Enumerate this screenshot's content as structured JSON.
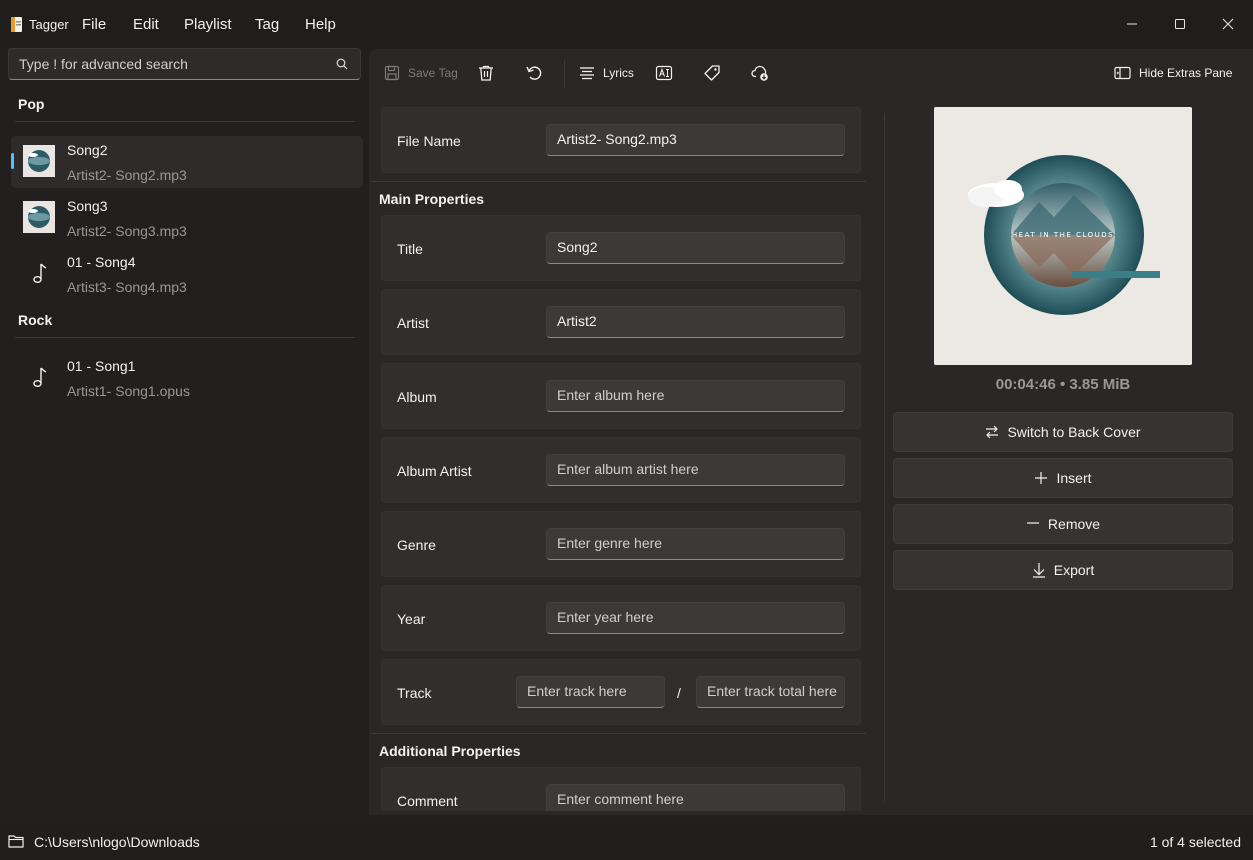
{
  "app": {
    "title": "Tagger"
  },
  "menu": {
    "file": "File",
    "edit": "Edit",
    "playlist": "Playlist",
    "tag": "Tag",
    "help": "Help"
  },
  "search": {
    "placeholder": "Type ! for advanced search"
  },
  "groups": [
    {
      "name": "Pop",
      "songs": [
        {
          "title": "Song2",
          "file": "Artist2- Song2.mp3",
          "art": "cover-thumb"
        },
        {
          "title": "Song3",
          "file": "Artist2- Song3.mp3",
          "art": "cover-thumb"
        },
        {
          "title": "01 - Song4",
          "file": "Artist3- Song4.mp3",
          "art": "music-note-icon"
        }
      ]
    },
    {
      "name": "Rock",
      "songs": [
        {
          "title": "01 - Song1",
          "file": "Artist1- Song1.opus",
          "art": "music-note-icon"
        }
      ]
    }
  ],
  "toolbar": {
    "save_tag": "Save Tag",
    "lyrics": "Lyrics",
    "hide_extras": "Hide Extras Pane"
  },
  "fields": {
    "file_name": {
      "label": "File Name",
      "value": "Artist2- Song2.mp3"
    },
    "main_section": "Main Properties",
    "title": {
      "label": "Title",
      "value": "Song2"
    },
    "artist": {
      "label": "Artist",
      "value": "Artist2"
    },
    "album": {
      "label": "Album",
      "placeholder": "Enter album here"
    },
    "album_artist": {
      "label": "Album Artist",
      "placeholder": "Enter album artist here"
    },
    "genre": {
      "label": "Genre",
      "placeholder": "Enter genre here"
    },
    "year": {
      "label": "Year",
      "placeholder": "Enter year here"
    },
    "track": {
      "label": "Track",
      "placeholder": "Enter track here",
      "separator": "/",
      "total_placeholder": "Enter track total here"
    },
    "additional_section": "Additional Properties",
    "comment": {
      "label": "Comment",
      "placeholder": "Enter comment here"
    }
  },
  "cover": {
    "text": "HEAT IN THE CLOUDS"
  },
  "extras": {
    "media_info": "00:04:46 • 3.85 MiB",
    "switch_cover": "Switch to Back Cover",
    "insert": "Insert",
    "remove": "Remove",
    "export": "Export"
  },
  "status": {
    "path": "C:\\Users\\nlogo\\Downloads",
    "selection": "1 of 4 selected"
  },
  "colors": {
    "accent": "#4cc2ff",
    "background": "#221f1e",
    "panel": "#2a2726"
  }
}
